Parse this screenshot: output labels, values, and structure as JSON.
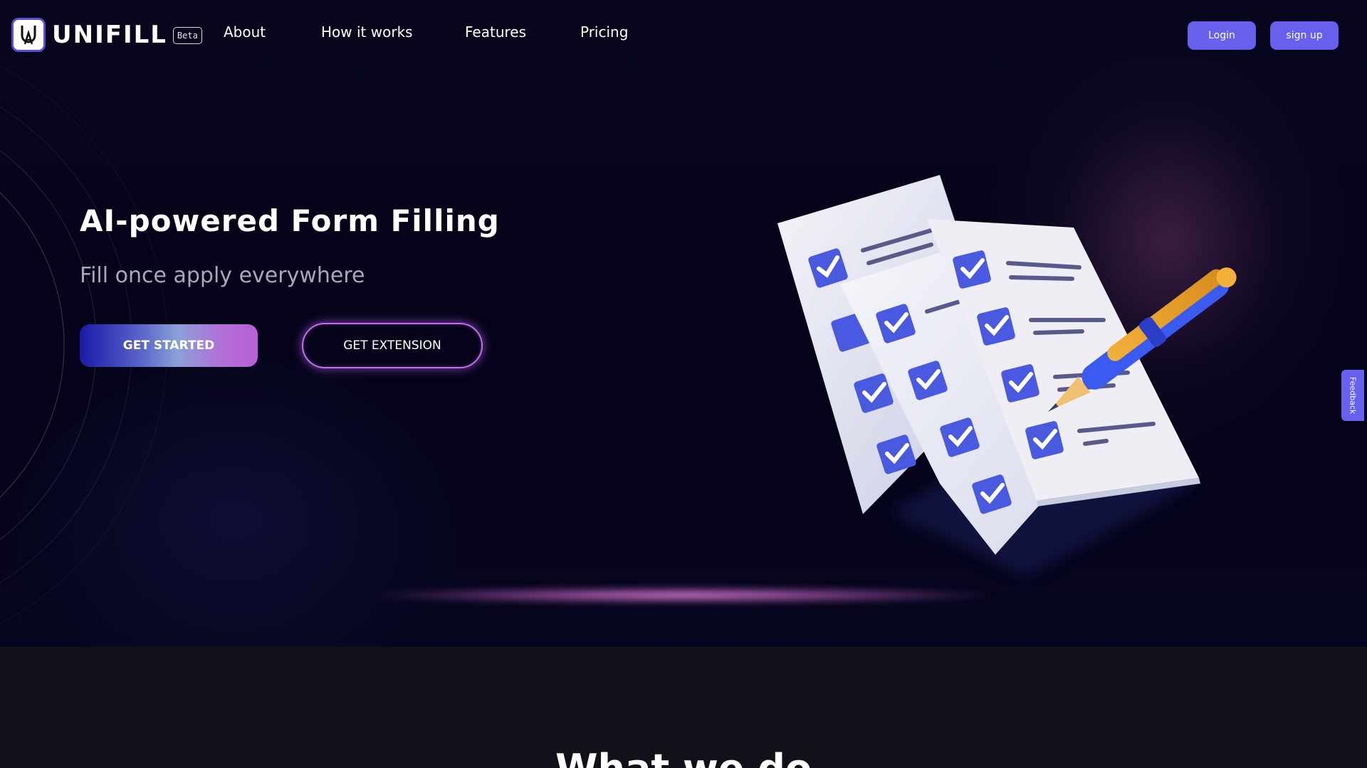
{
  "nav": {
    "logo_text": "UNIFILL",
    "beta_badge": "Beta",
    "links": [
      "About",
      "How it works",
      "Features",
      "Pricing"
    ],
    "login_label": "Login",
    "signup_label": "sign up"
  },
  "hero": {
    "title": "AI-powered Form Filling",
    "subtitle": "Fill once apply everywhere",
    "get_started_label": "GET STARTED",
    "get_extension_label": "GET EXTENSION"
  },
  "feedback_tab": {
    "label": "Feedback"
  },
  "section2": {
    "title": "What we do"
  },
  "colors": {
    "accent": "#6660ec",
    "background": "#05041a",
    "section_bg": "#111119",
    "glow": "#c070e8",
    "checkbox": "#4a5ae0",
    "pen_body": "#f0a62a"
  },
  "icons": {
    "logo": "unifill-logo-icon",
    "illustration": "checklist-documents-pen-illustration"
  }
}
